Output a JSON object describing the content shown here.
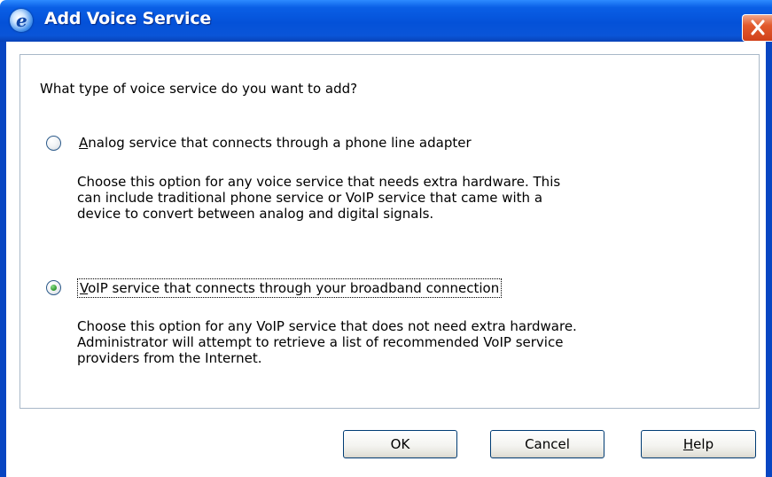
{
  "window": {
    "title": "Add Voice Service",
    "app_icon": "ie-e-icon",
    "app_icon_letter": "e",
    "close_icon": "close-x-icon"
  },
  "dialog": {
    "question": "What type of voice service do you want to add?",
    "options": [
      {
        "id": "analog",
        "mnemonic": "A",
        "label_rest": "nalog service that connects through a phone line adapter",
        "selected": false,
        "description_lines": [
          "Choose this option for any voice service that needs extra hardware. This",
          "can include traditional phone service or VoIP service that came with a",
          "device to convert between analog and digital signals."
        ]
      },
      {
        "id": "voip",
        "mnemonic": "V",
        "label_rest": "oIP service that connects through your broadband connection",
        "selected": true,
        "description_lines": [
          "Choose this option for any VoIP service that does not need extra hardware.",
          "Administrator will attempt to retrieve a list of recommended VoIP service",
          "providers from the Internet."
        ]
      }
    ]
  },
  "buttons": {
    "ok": "OK",
    "cancel": "Cancel",
    "help_mnemonic": "H",
    "help_rest": "elp"
  },
  "colors": {
    "titlebar": "#0451d8",
    "close_button": "#e25a2c",
    "frame": "#0846c2",
    "panel_border": "#a9b8c8",
    "radio_selected": "#3aa03a"
  }
}
